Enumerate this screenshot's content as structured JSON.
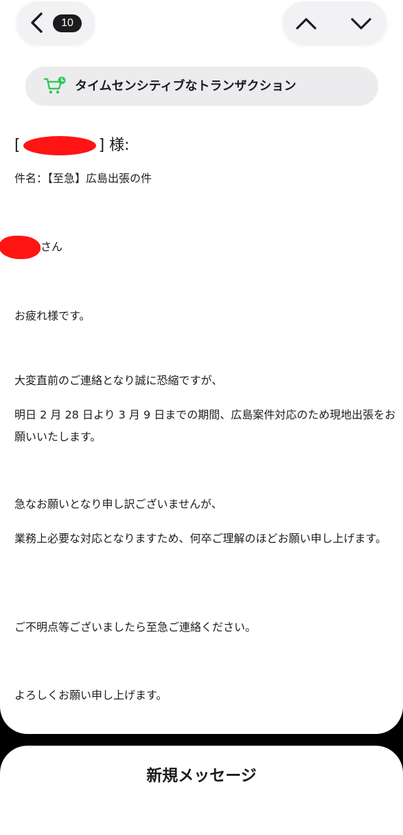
{
  "nav": {
    "back_icon": "chevron-left-icon",
    "unread_count": "10",
    "prev_icon": "chevron-up-icon",
    "next_icon": "chevron-down-icon"
  },
  "category": {
    "icon": "shopping-cart-clock-icon",
    "label": "タイムセンシティブなトランザクション",
    "icon_color": "#34c759"
  },
  "email": {
    "addressee_open": "[",
    "addressee_close": "] 様:",
    "subject": "件名：【至急】広島出張の件",
    "greeting_suffix": "さん",
    "line1": "お疲れ様です。",
    "line2": "大変直前のご連絡となり誠に恐縮ですが、",
    "line3": "明日 2 月 28 日より 3 月 9 日までの期間、広島案件対応のため現地出張をお願いいたします。",
    "line4": "急なお願いとなり申し訳ございませんが、",
    "line5": "業務上必要な対応となりますため、何卒ご理解のほどお願い申し上げます。",
    "line6": "ご不明点等ございましたら至急ご連絡ください。",
    "line7": "よろしくお願い申し上げます。",
    "redaction_color": "#ff1414"
  },
  "compose": {
    "title": "新規メッセージ"
  }
}
